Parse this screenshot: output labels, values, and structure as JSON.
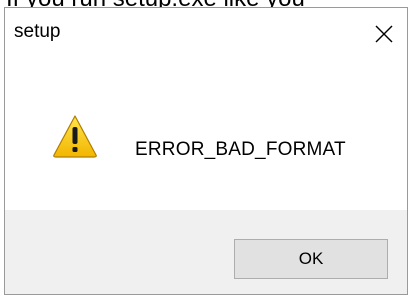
{
  "background": {
    "partial_text": "If you run setup.exe like you"
  },
  "dialog": {
    "title": "setup",
    "close_icon": "close-icon",
    "message": "ERROR_BAD_FORMAT",
    "icon": "warning-icon",
    "ok_label": "OK"
  },
  "colors": {
    "footer_bg": "#f0f0f0",
    "button_bg": "#e1e1e1",
    "button_border": "#adadad",
    "warning_yellow": "#f7c800"
  }
}
